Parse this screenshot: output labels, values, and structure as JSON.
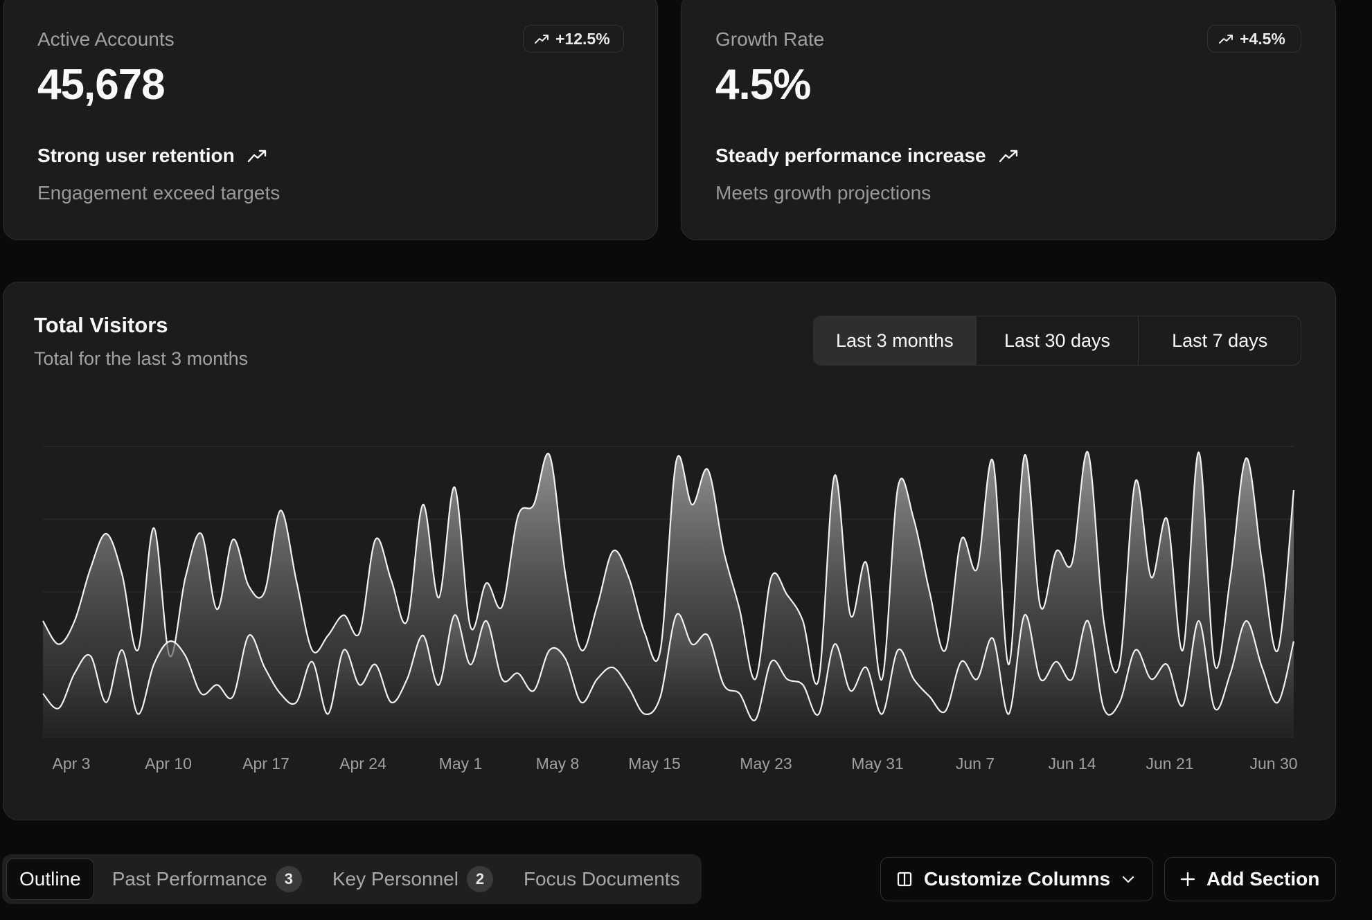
{
  "stats": [
    {
      "label": "Active Accounts",
      "value": "45,678",
      "badge": "+12.5%",
      "headline": "Strong user retention",
      "subtext": "Engagement exceed targets"
    },
    {
      "label": "Growth Rate",
      "value": "4.5%",
      "badge": "+4.5%",
      "headline": "Steady performance increase",
      "subtext": "Meets growth projections"
    }
  ],
  "visitors": {
    "title": "Total Visitors",
    "subtitle": "Total for the last 3 months",
    "ranges": [
      "Last 3 months",
      "Last 30 days",
      "Last 7 days"
    ],
    "active_range": "Last 3 months"
  },
  "chart_data": {
    "type": "area",
    "x_tick_labels": [
      "Apr 3",
      "Apr 10",
      "Apr 17",
      "Apr 24",
      "May 1",
      "May 8",
      "May 15",
      "May 23",
      "May 31",
      "Jun 7",
      "Jun 14",
      "Jun 21",
      "Jun 30"
    ],
    "grid": true,
    "ylim": [
      0,
      100
    ],
    "series": [
      {
        "values": [
          40,
          32,
          40,
          58,
          70,
          56,
          30,
          72,
          28,
          55,
          70,
          44,
          68,
          52,
          50,
          78,
          54,
          30,
          35,
          42,
          36,
          68,
          54,
          40,
          80,
          48,
          86,
          38,
          53,
          45,
          76,
          80,
          97,
          56,
          30,
          45,
          64,
          55,
          36,
          30,
          95,
          80,
          92,
          64,
          44,
          20,
          55,
          49,
          40,
          20,
          90,
          42,
          60,
          20,
          86,
          75,
          50,
          30,
          68,
          58,
          95,
          25,
          97,
          45,
          64,
          60,
          98,
          40,
          25,
          88,
          55,
          75,
          30,
          98,
          25,
          55,
          96,
          60,
          30,
          85
        ]
      },
      {
        "values": [
          15,
          10,
          22,
          28,
          12,
          30,
          8,
          25,
          33,
          28,
          15,
          18,
          14,
          35,
          24,
          15,
          12,
          26,
          8,
          30,
          18,
          25,
          12,
          20,
          35,
          18,
          42,
          25,
          40,
          20,
          22,
          16,
          30,
          27,
          12,
          20,
          24,
          17,
          8,
          14,
          42,
          32,
          35,
          18,
          15,
          6,
          26,
          20,
          18,
          8,
          32,
          16,
          24,
          8,
          30,
          20,
          14,
          9,
          26,
          20,
          34,
          8,
          42,
          20,
          26,
          20,
          40,
          10,
          12,
          30,
          20,
          25,
          11,
          40,
          10,
          22,
          40,
          24,
          12,
          33
        ]
      }
    ]
  },
  "toolbar": {
    "tabs": [
      {
        "label": "Outline"
      },
      {
        "label": "Past Performance",
        "count": "3"
      },
      {
        "label": "Key Personnel",
        "count": "2"
      },
      {
        "label": "Focus Documents"
      }
    ],
    "customize_label": "Customize Columns",
    "add_label": "Add Section"
  },
  "icons": {
    "trend": "trending-up-icon",
    "columns": "columns-icon",
    "chevron": "chevron-down-icon",
    "plus": "plus-icon"
  }
}
